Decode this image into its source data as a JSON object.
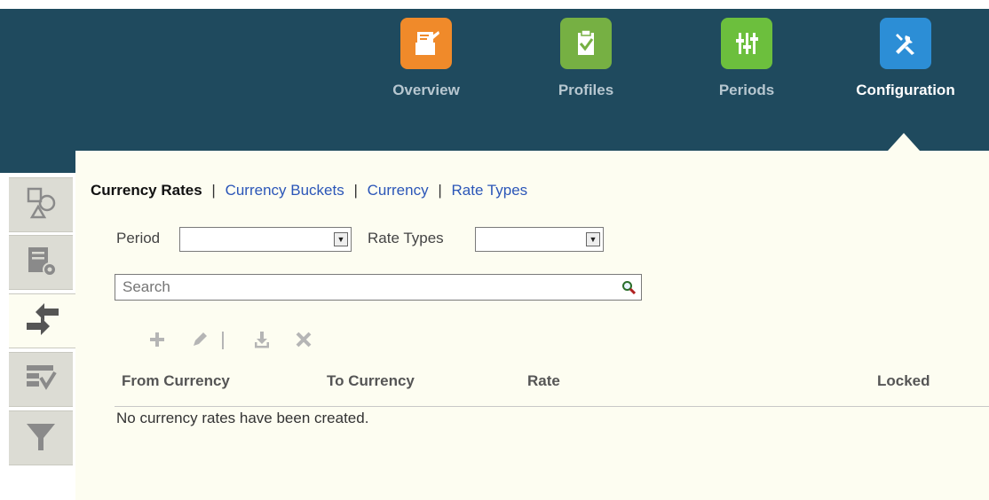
{
  "nav": {
    "tiles": [
      {
        "label": "Overview",
        "icon": "overview-icon",
        "color": "#f08a2a"
      },
      {
        "label": "Profiles",
        "icon": "profiles-icon",
        "color": "#76b043"
      },
      {
        "label": "Periods",
        "icon": "periods-icon",
        "color": "#6cbf3d"
      },
      {
        "label": "Configuration",
        "icon": "configuration-icon",
        "color": "#2c8ed6",
        "active": true
      }
    ]
  },
  "sidebar": {
    "tabs": [
      {
        "icon": "shapes-icon"
      },
      {
        "icon": "doc-settings-icon"
      },
      {
        "icon": "exchange-arrows-icon",
        "active": true
      },
      {
        "icon": "form-check-icon"
      },
      {
        "icon": "filter-icon"
      }
    ]
  },
  "subnav": {
    "current": "Currency Rates",
    "sep": "|",
    "links": [
      "Currency Buckets",
      "Currency",
      "Rate Types"
    ]
  },
  "filters": {
    "period_label": "Period",
    "period_value": "",
    "rate_types_label": "Rate Types",
    "rate_types_value": ""
  },
  "search": {
    "placeholder": "Search"
  },
  "toolbar": [
    "add-icon",
    "edit-icon",
    "import-icon",
    "delete-icon"
  ],
  "table": {
    "columns": [
      "From Currency",
      "To Currency",
      "Rate",
      "Locked"
    ],
    "empty_message": "No currency rates have been created."
  },
  "colors": {
    "header_bg": "#1f4a5e",
    "panel_bg": "#fdfdf1",
    "link": "#2b56b8"
  }
}
